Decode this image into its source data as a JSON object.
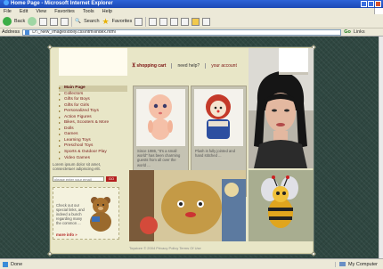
{
  "browser": {
    "title": "Home Page - Microsoft Internet Explorer",
    "menu": [
      "File",
      "Edit",
      "View",
      "Favorites",
      "Tools",
      "Help"
    ],
    "toolbar": {
      "back_label": "Back",
      "search_label": "Search",
      "favorites_label": "Favorites"
    },
    "address_label": "Address",
    "address_value": "D:\\_New_Images\\dolly.css\\html\\index.html",
    "go_label": "Go",
    "links_label": "Links"
  },
  "site": {
    "topnav": {
      "cart": "shopping cart",
      "help": "need help?",
      "account": "your account"
    },
    "categories": [
      "Main Page",
      "Collectors",
      "Gifts for Boys",
      "Gifts for Girls",
      "Personalized Toys",
      "Action Figures",
      "Bikes, Scooters & More",
      "Dolls",
      "Games",
      "Learning Toys",
      "Preschool Toys",
      "Sports & Outdoor Play",
      "Video Games"
    ],
    "newsletter_text": "Lorem ipsum dolor sit amet, consectetuer adipiscing elit.",
    "email_placeholder": "please enter your email",
    "email_go": "GO",
    "promo_text": "Check out our special links, and indeed a bunch regarding many the common ...",
    "promo_more": "more info »",
    "products": [
      {
        "desc": "Since 1986, \"It's a small world\" has been charming guests from all over the world ...",
        "buy": "buy",
        "add": "add to cart",
        "view": "view"
      },
      {
        "desc": "Plush is fully jointed and hand stitched ...",
        "buy": "buy",
        "add": "add to cart",
        "view": "view"
      }
    ],
    "footer": "Toystore © 2004 Privacy Policy Terms Of Use"
  },
  "status": {
    "text": "Done",
    "zone": "My Computer"
  },
  "colors": {
    "accent": "#7a1a1a",
    "background": "#2f4741",
    "panel": "#e8e6c7",
    "go_button": "#b41e1e"
  }
}
